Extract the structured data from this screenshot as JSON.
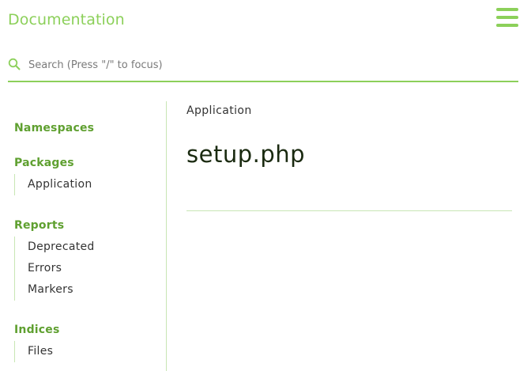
{
  "header": {
    "title": "Documentation",
    "menu_icon": "hamburger-icon"
  },
  "search": {
    "icon": "search-icon",
    "placeholder": "Search (Press \"/\" to focus)",
    "value": ""
  },
  "sidebar": {
    "sections": [
      {
        "heading": "Namespaces",
        "items": []
      },
      {
        "heading": "Packages",
        "items": [
          "Application"
        ]
      },
      {
        "heading": "Reports",
        "items": [
          "Deprecated",
          "Errors",
          "Markers"
        ]
      },
      {
        "heading": "Indices",
        "items": [
          "Files"
        ]
      }
    ]
  },
  "main": {
    "breadcrumb": "Application",
    "title": "setup.php"
  },
  "colors": {
    "accent": "#8cd05a",
    "heading": "#5fa030",
    "divider": "#c8e6b4"
  }
}
